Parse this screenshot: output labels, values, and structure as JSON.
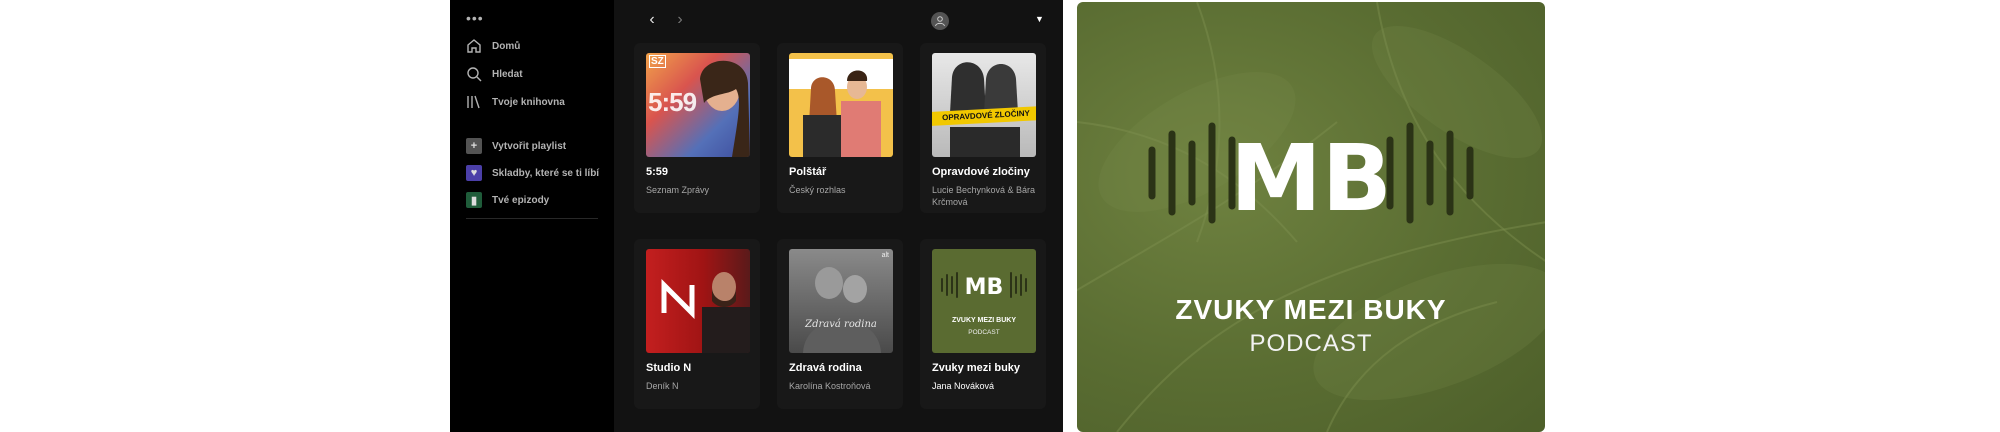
{
  "sidebar": {
    "more": "•••",
    "nav": [
      {
        "label": "Domů",
        "icon": "home-icon"
      },
      {
        "label": "Hledat",
        "icon": "search-icon"
      },
      {
        "label": "Tvoje knihovna",
        "icon": "library-icon"
      }
    ],
    "library": [
      {
        "label": "Vytvořit playlist",
        "icon": "plus-icon",
        "color": "#535353"
      },
      {
        "label": "Skladby, které se ti líbí",
        "icon": "heart-icon",
        "color": "#4b3fa8"
      },
      {
        "label": "Tvé epizody",
        "icon": "bookmark-icon",
        "color": "#1f5c3a"
      }
    ]
  },
  "topbar": {
    "back": "‹",
    "forward": "›",
    "caret": "▼"
  },
  "cards": [
    {
      "title": "5:59",
      "subtitle": "Seznam Zprávy",
      "cover": {
        "badge": "SZ",
        "text": "5:59"
      }
    },
    {
      "title": "Polštář",
      "subtitle": "Český rozhlas"
    },
    {
      "title": "Opravdové zločiny",
      "subtitle": "Lucie Bechynková & Bára Krčmová",
      "cover": {
        "tape": "OPRAVDOVÉ ZLOČINY"
      }
    },
    {
      "title": "Studio N",
      "subtitle": "Deník N"
    },
    {
      "title": "Zdravá rodina",
      "subtitle": "Karolína Kostroňová",
      "cover": {
        "script": "Zdravá rodina",
        "mark": "alt"
      }
    },
    {
      "title": "Zvuky mezi buky",
      "subtitle": "Jana Nováková",
      "cover": {
        "line1": "ZVUKY MEZI BUKY",
        "line2": "PODCAST"
      }
    }
  ],
  "podcast_cover": {
    "monogram": "MB",
    "title": "ZVUKY MEZI BUKY",
    "subtitle": "PODCAST",
    "background": "#5a6d32"
  }
}
